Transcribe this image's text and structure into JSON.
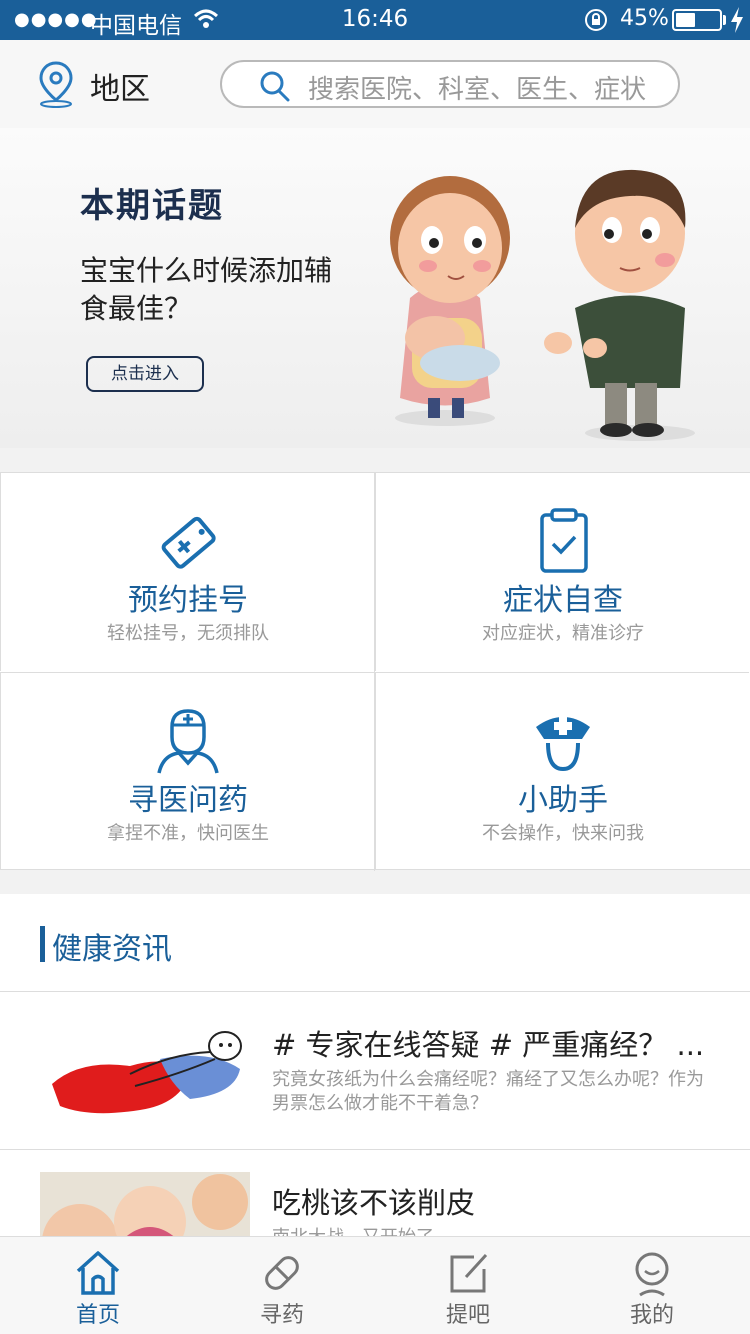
{
  "status_bar": {
    "signal": "●●●●●",
    "carrier": "中国电信",
    "time": "16:46",
    "battery": "45%",
    "battery_level": 0.45
  },
  "header": {
    "region_label": "地区",
    "search_placeholder": "搜索医院、科室、医生、症状"
  },
  "banner": {
    "title": "本期话题",
    "subtitle": "宝宝什么时候添加辅食最佳？",
    "button_label": "点击进入"
  },
  "features": [
    {
      "title": "预约挂号",
      "subtitle": "轻松挂号，无须排队",
      "icon": "tag-icon"
    },
    {
      "title": "症状自查",
      "subtitle": "对应症状，精准诊疗",
      "icon": "clipboard-check-icon"
    },
    {
      "title": "寻医问药",
      "subtitle": "拿捏不准，快问医生",
      "icon": "doctor-icon"
    },
    {
      "title": "小助手",
      "subtitle": "不会操作，快来问我",
      "icon": "nurse-icon"
    }
  ],
  "news": {
    "section_title": "健康资讯",
    "articles": [
      {
        "title": "# 专家在线答疑 # 严重痛经？ ...",
        "desc": "究竟女孩纸为什么会痛经呢？痛经了又怎么办呢？作为男票怎么做才能不干着急？"
      },
      {
        "title": "吃桃该不该削皮",
        "desc": "南北大战，又开始了"
      }
    ]
  },
  "tabs": [
    {
      "label": "首页",
      "icon": "home-icon",
      "active": true
    },
    {
      "label": "寻药",
      "icon": "pill-icon",
      "active": false
    },
    {
      "label": "提吧",
      "icon": "edit-icon",
      "active": false
    },
    {
      "label": "我的",
      "icon": "user-icon",
      "active": false
    }
  ],
  "colors": {
    "brand": "#1a5f99",
    "banner_text": "#1c2f4e"
  }
}
